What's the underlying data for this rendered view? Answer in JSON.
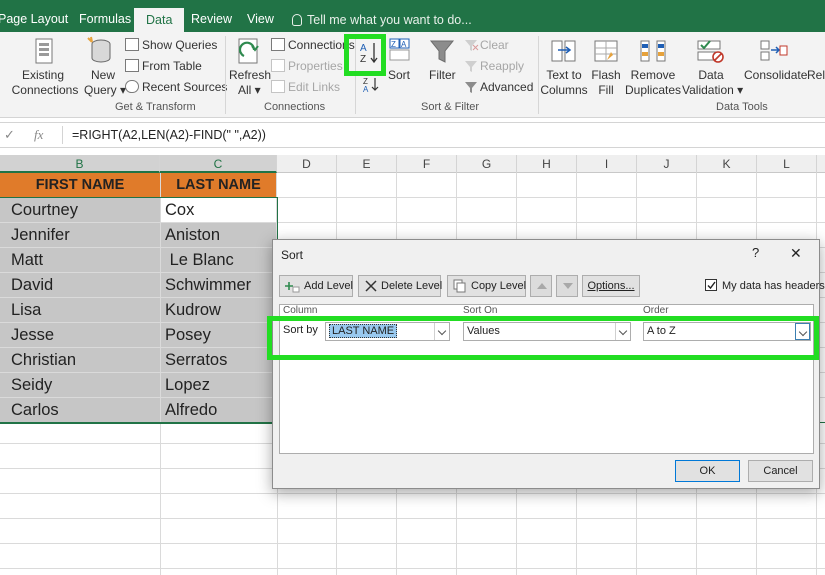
{
  "ribbon_tabs": [
    "Page Layout",
    "Formulas",
    "Data",
    "Review",
    "View"
  ],
  "active_tab": "Data",
  "tell_me": "Tell me what you want to do...",
  "ribbon": {
    "existing_connections": [
      "Existing",
      "Connections"
    ],
    "new_query": [
      "New",
      "Query"
    ],
    "show_queries": "Show Queries",
    "from_table": "From Table",
    "recent_sources": "Recent Sources",
    "group_get_transform": "Get & Transform",
    "refresh_all": [
      "Refresh",
      "All"
    ],
    "connections": "Connections",
    "properties": "Properties",
    "edit_links": "Edit Links",
    "group_connections": "Connections",
    "sort": "Sort",
    "filter": "Filter",
    "clear": "Clear",
    "reapply": "Reapply",
    "advanced": "Advanced",
    "group_sort_filter": "Sort & Filter",
    "text_to_columns": [
      "Text to",
      "Columns"
    ],
    "flash_fill": [
      "Flash",
      "Fill"
    ],
    "remove_duplicates": [
      "Remove",
      "Duplicates"
    ],
    "data_validation": [
      "Data",
      "Validation"
    ],
    "consolidate": "Consolidate",
    "relationships": "Rela",
    "group_data_tools": "Data Tools"
  },
  "formula_bar": {
    "cancel": "✓",
    "fx": "fx",
    "formula": "=RIGHT(A2,LEN(A2)-FIND(\" \",A2))"
  },
  "columns": [
    "B",
    "C",
    "D",
    "E",
    "F",
    "G",
    "H",
    "I",
    "J",
    "K",
    "L"
  ],
  "table": {
    "headers": [
      "FIRST NAME",
      "LAST NAME"
    ],
    "rows": [
      [
        "Courtney",
        "Cox"
      ],
      [
        "Jennifer",
        "Aniston"
      ],
      [
        "Matt",
        " Le Blanc"
      ],
      [
        "David",
        "Schwimmer"
      ],
      [
        "Lisa",
        "Kudrow"
      ],
      [
        "Jesse",
        "Posey"
      ],
      [
        "Christian",
        "Serratos"
      ],
      [
        "Seidy",
        "Lopez"
      ],
      [
        "Carlos",
        "Alfredo"
      ]
    ]
  },
  "dialog": {
    "title": "Sort",
    "help": "?",
    "close": "✕",
    "add_level": "Add Level",
    "delete_level": "Delete Level",
    "copy_level": "Copy Level",
    "options": "Options...",
    "my_data_has_headers": "My data has headers",
    "headers_checked": true,
    "col_column": "Column",
    "col_sort_on": "Sort On",
    "col_order": "Order",
    "sort_by_label": "Sort by",
    "sort_by_value": "LAST NAME",
    "sort_on_value": "Values",
    "order_value": "A to Z",
    "ok": "OK",
    "cancel": "Cancel"
  },
  "colors": {
    "ribbon_green": "#217346",
    "header_orange": "#e07b2a",
    "highlight_green": "#22dd22"
  }
}
